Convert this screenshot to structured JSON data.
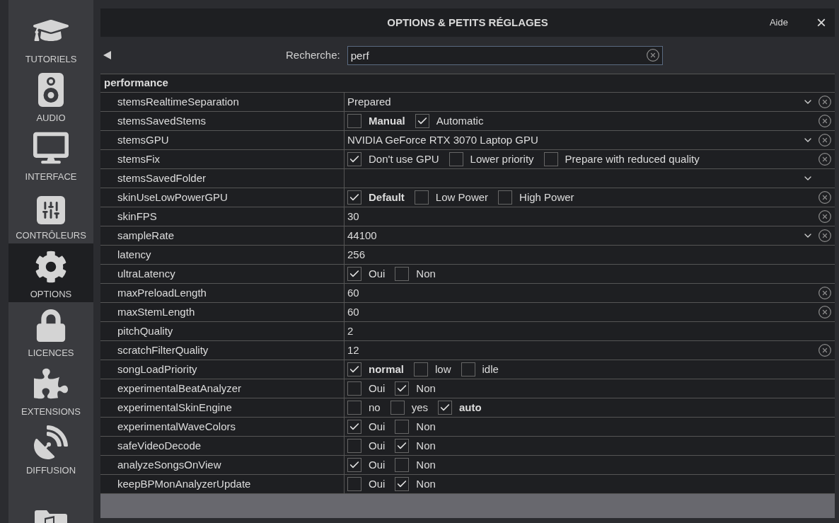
{
  "sidebar": {
    "items": [
      {
        "label": "TUTORIELS",
        "selected": false
      },
      {
        "label": "AUDIO",
        "selected": false
      },
      {
        "label": "INTERFACE",
        "selected": false
      },
      {
        "label": "CONTRÔLEURS",
        "selected": false
      },
      {
        "label": "OPTIONS",
        "selected": true
      },
      {
        "label": "LICENCES",
        "selected": false
      },
      {
        "label": "EXTENSIONS",
        "selected": false
      },
      {
        "label": "DIFFUSION",
        "selected": false
      },
      {
        "selected": false
      }
    ]
  },
  "window": {
    "title": "OPTIONS & PETITS RÉGLAGES",
    "help": "Aide",
    "close": "×"
  },
  "search": {
    "label": "Recherche:",
    "value": "perf"
  },
  "table": {
    "group": "performance",
    "rows": [
      {
        "name": "stemsRealtimeSeparation",
        "kind": "select",
        "value": "Prepared",
        "clearable": true
      },
      {
        "name": "stemsSavedStems",
        "kind": "options",
        "options": [
          {
            "label": "Manual",
            "checked": false,
            "default": true
          },
          {
            "label": "Automatic",
            "checked": true,
            "default": false
          }
        ],
        "clearable": true
      },
      {
        "name": "stemsGPU",
        "kind": "select",
        "value": "NVIDIA GeForce RTX 3070 Laptop GPU",
        "clearable": true
      },
      {
        "name": "stemsFix",
        "kind": "options",
        "options": [
          {
            "label": "Don't use GPU",
            "checked": true,
            "default": false
          },
          {
            "label": "Lower priority",
            "checked": false,
            "default": false
          },
          {
            "label": "Prepare with reduced quality",
            "checked": false,
            "default": false
          }
        ],
        "clearable": true
      },
      {
        "name": "stemsSavedFolder",
        "kind": "select",
        "value": "",
        "clearable": false
      },
      {
        "name": "skinUseLowPowerGPU",
        "kind": "options",
        "options": [
          {
            "label": "Default",
            "checked": true,
            "default": true
          },
          {
            "label": "Low Power",
            "checked": false,
            "default": false
          },
          {
            "label": "High Power",
            "checked": false,
            "default": false
          }
        ],
        "clearable": true
      },
      {
        "name": "skinFPS",
        "kind": "text",
        "value": "30",
        "clearable": true
      },
      {
        "name": "sampleRate",
        "kind": "select",
        "value": "44100",
        "clearable": true
      },
      {
        "name": "latency",
        "kind": "text",
        "value": "256",
        "clearable": false
      },
      {
        "name": "ultraLatency",
        "kind": "options",
        "options": [
          {
            "label": "Oui",
            "checked": true,
            "default": false
          },
          {
            "label": "Non",
            "checked": false,
            "default": false
          }
        ],
        "clearable": false
      },
      {
        "name": "maxPreloadLength",
        "kind": "text",
        "value": "60",
        "clearable": true
      },
      {
        "name": "maxStemLength",
        "kind": "text",
        "value": "60",
        "clearable": true
      },
      {
        "name": "pitchQuality",
        "kind": "text",
        "value": "2",
        "clearable": false
      },
      {
        "name": "scratchFilterQuality",
        "kind": "text",
        "value": "12",
        "clearable": true
      },
      {
        "name": "songLoadPriority",
        "kind": "options",
        "options": [
          {
            "label": "normal",
            "checked": true,
            "default": true
          },
          {
            "label": "low",
            "checked": false,
            "default": false
          },
          {
            "label": "idle",
            "checked": false,
            "default": false
          }
        ],
        "clearable": false
      },
      {
        "name": "experimentalBeatAnalyzer",
        "kind": "options",
        "options": [
          {
            "label": "Oui",
            "checked": false,
            "default": false
          },
          {
            "label": "Non",
            "checked": true,
            "default": false
          }
        ],
        "clearable": false
      },
      {
        "name": "experimentalSkinEngine",
        "kind": "options",
        "options": [
          {
            "label": "no",
            "checked": false,
            "default": false
          },
          {
            "label": "yes",
            "checked": false,
            "default": false
          },
          {
            "label": "auto",
            "checked": true,
            "default": true
          }
        ],
        "clearable": false
      },
      {
        "name": "experimentalWaveColors",
        "kind": "options",
        "options": [
          {
            "label": "Oui",
            "checked": true,
            "default": false
          },
          {
            "label": "Non",
            "checked": false,
            "default": false
          }
        ],
        "clearable": false
      },
      {
        "name": "safeVideoDecode",
        "kind": "options",
        "options": [
          {
            "label": "Oui",
            "checked": false,
            "default": false
          },
          {
            "label": "Non",
            "checked": true,
            "default": false
          }
        ],
        "clearable": false
      },
      {
        "name": "analyzeSongsOnView",
        "kind": "options",
        "options": [
          {
            "label": "Oui",
            "checked": true,
            "default": false
          },
          {
            "label": "Non",
            "checked": false,
            "default": false
          }
        ],
        "clearable": false
      },
      {
        "name": "keepBPMonAnalyzerUpdate",
        "kind": "options",
        "options": [
          {
            "label": "Oui",
            "checked": false,
            "default": false
          },
          {
            "label": "Non",
            "checked": true,
            "default": false
          }
        ],
        "clearable": false
      }
    ]
  }
}
